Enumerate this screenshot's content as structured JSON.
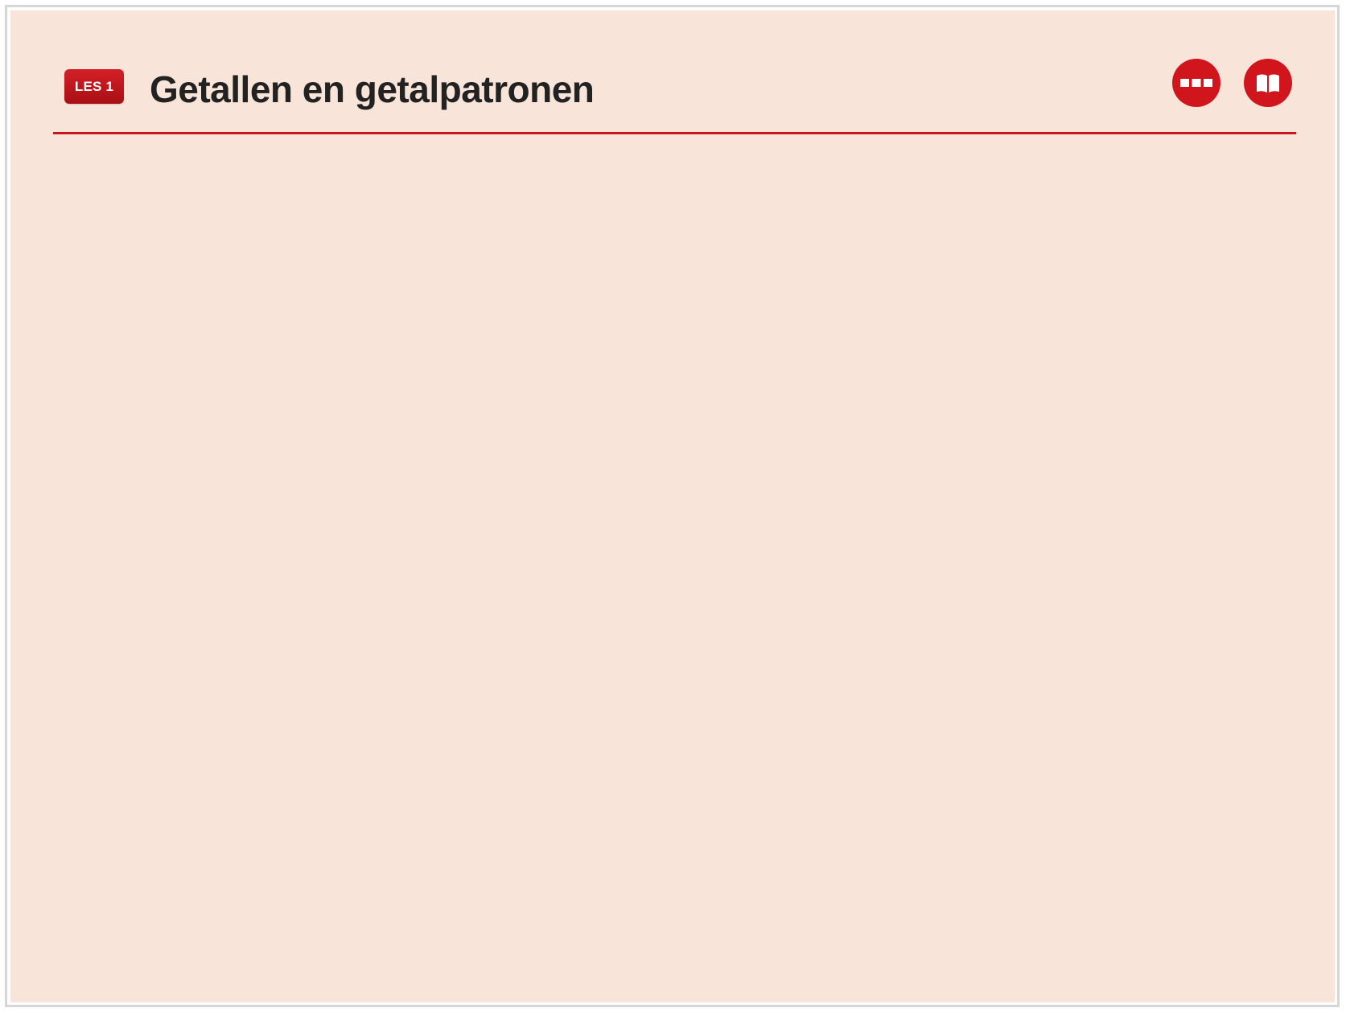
{
  "lesson": {
    "badge_label": "LES 1",
    "title": "Getallen en getalpatronen"
  },
  "toolbar": {
    "more_icon": "more-icon",
    "book_icon": "book-icon"
  },
  "colors": {
    "background": "#f9e4da",
    "accent": "#d0151c",
    "title_text": "#222222"
  }
}
